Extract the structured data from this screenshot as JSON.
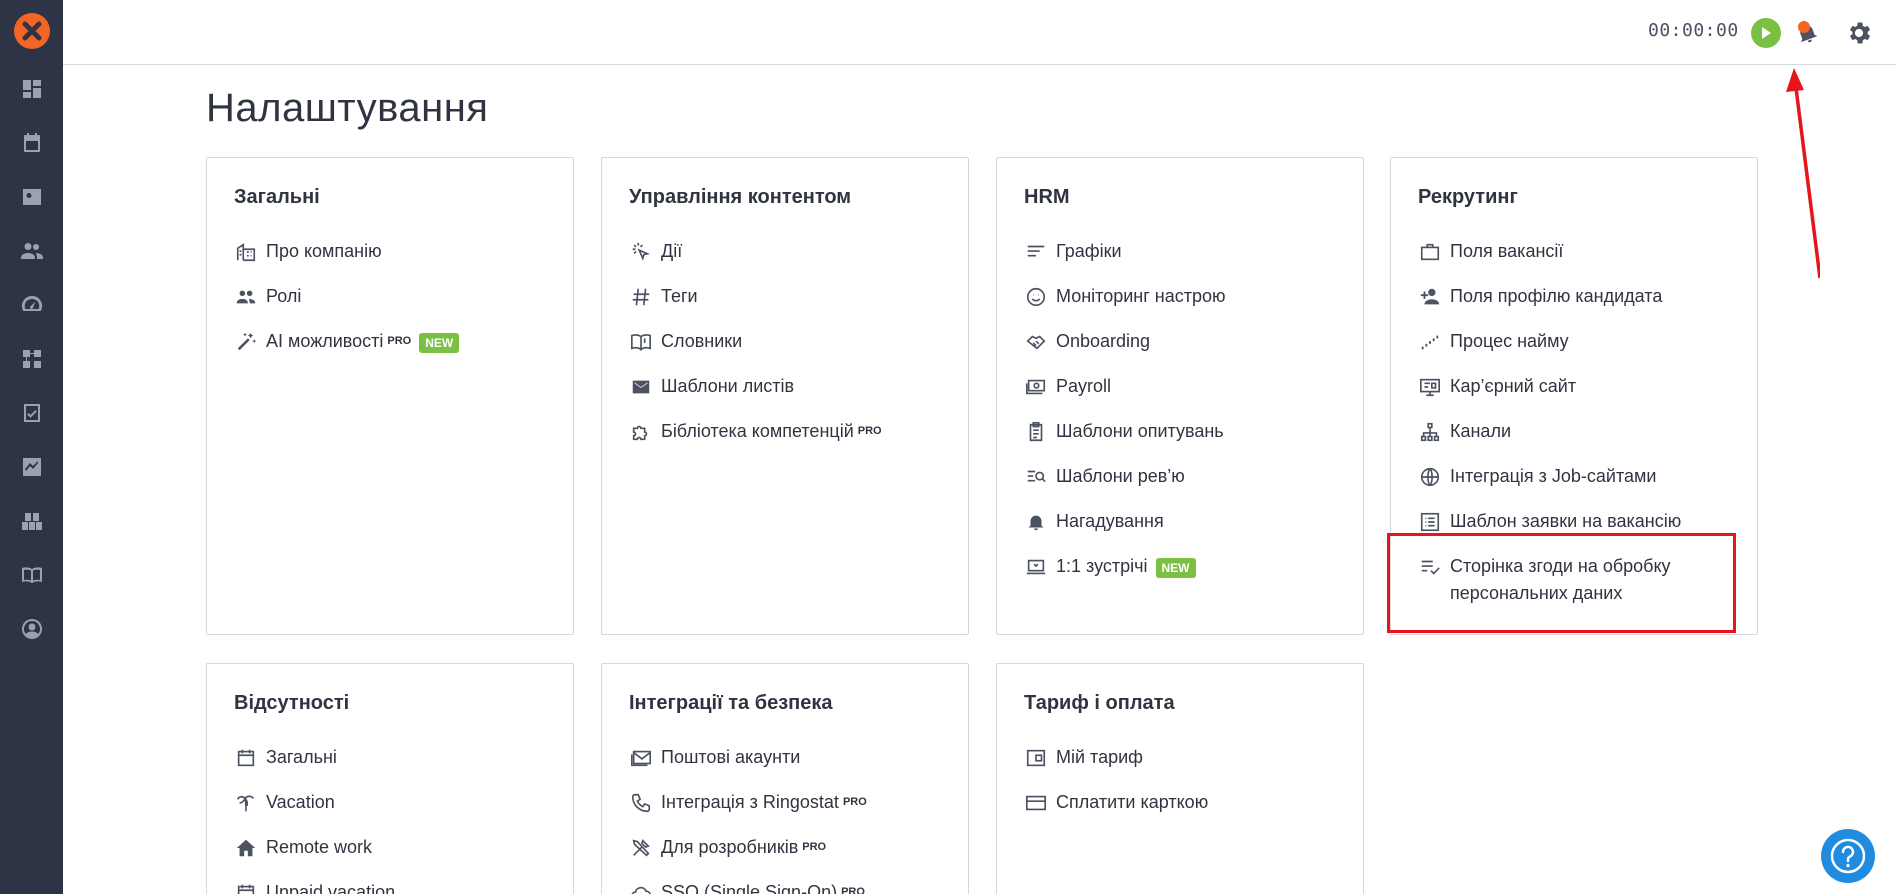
{
  "topbar": {
    "timer": "00:00:00"
  },
  "page": {
    "title": "Налаштування"
  },
  "cards": {
    "general": {
      "title": "Загальні",
      "items": [
        {
          "label": "Про компанію",
          "icon": "building-icon"
        },
        {
          "label": "Ролі",
          "icon": "people-icon"
        },
        {
          "label": "AI можливості",
          "icon": "magic-wand-icon",
          "pro": "PRO",
          "badge": "NEW"
        }
      ]
    },
    "content": {
      "title": "Управління контентом",
      "items": [
        {
          "label": "Дії",
          "icon": "click-icon"
        },
        {
          "label": "Теги",
          "icon": "hash-icon"
        },
        {
          "label": "Словники",
          "icon": "book-icon"
        },
        {
          "label": "Шаблони листів",
          "icon": "mail-icon"
        },
        {
          "label": "Бібліотека компетенцій",
          "icon": "puzzle-icon",
          "pro": "PRO"
        }
      ]
    },
    "hrm": {
      "title": "HRM",
      "items": [
        {
          "label": "Графіки",
          "icon": "lines-icon"
        },
        {
          "label": "Моніторинг настрою",
          "icon": "smile-icon"
        },
        {
          "label": "Onboarding",
          "icon": "handshake-icon"
        },
        {
          "label": "Payroll",
          "icon": "money-icon"
        },
        {
          "label": "Шаблони опитувань",
          "icon": "clipboard-icon"
        },
        {
          "label": "Шаблони рев’ю",
          "icon": "review-search-icon"
        },
        {
          "label": "Нагадування",
          "icon": "bell-icon"
        },
        {
          "label": "1:1 зустрічі",
          "icon": "laptop-icon",
          "badge": "NEW"
        }
      ]
    },
    "recruiting": {
      "title": "Рекрутинг",
      "items": [
        {
          "label": "Поля вакансії",
          "icon": "briefcase-icon"
        },
        {
          "label": "Поля профілю кандидата",
          "icon": "person-add-icon"
        },
        {
          "label": "Процес найму",
          "icon": "stairs-icon"
        },
        {
          "label": "Кар’єрний сайт",
          "icon": "monitor-icon"
        },
        {
          "label": "Канали",
          "icon": "sitemap-icon"
        },
        {
          "label": "Інтеграція з Job-сайтами",
          "icon": "globe-icon"
        },
        {
          "label": "Шаблон заявки на вакансію",
          "icon": "list-icon"
        },
        {
          "label": "Сторінка згоди на обробку",
          "label2": "персональних даних",
          "icon": "playlist-check-icon"
        }
      ]
    },
    "absences": {
      "title": "Відсутності",
      "items": [
        {
          "label": "Загальні",
          "icon": "calendar-icon"
        },
        {
          "label": "Vacation",
          "icon": "palm-icon"
        },
        {
          "label": "Remote work",
          "icon": "home-icon"
        },
        {
          "label": "Unpaid vacation",
          "icon": "calendar-icon"
        }
      ]
    },
    "integrations": {
      "title": "Інтеграції та безпека",
      "items": [
        {
          "label": "Поштові акаунти",
          "icon": "mailbox-icon"
        },
        {
          "label": "Інтеграція з Ringostat",
          "icon": "phone-icon",
          "pro": "PRO"
        },
        {
          "label": "Для розробників",
          "icon": "tools-icon",
          "pro": "PRO"
        },
        {
          "label": "SSO (Single Sign-On)",
          "icon": "cloud-icon",
          "pro": "PRO"
        }
      ]
    },
    "billing": {
      "title": "Тариф і оплата",
      "items": [
        {
          "label": "Мій тариф",
          "icon": "wallet-icon"
        },
        {
          "label": "Сплатити карткою",
          "icon": "card-icon"
        }
      ]
    }
  },
  "colors": {
    "sidebar": "#2e3446",
    "accent": "#f26522",
    "green": "#7ac143",
    "highlight": "#e8141c",
    "help": "#1f8ce0"
  }
}
